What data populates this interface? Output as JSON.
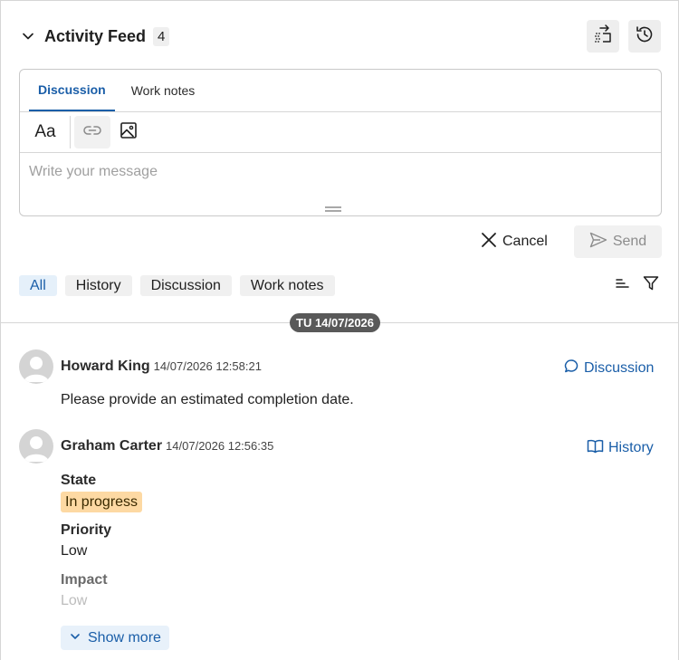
{
  "header": {
    "title": "Activity Feed",
    "count": "4"
  },
  "composer": {
    "tabs": [
      {
        "label": "Discussion"
      },
      {
        "label": "Work notes"
      }
    ],
    "toolbar": {
      "text_format_label": "Aa"
    },
    "placeholder": "Write your message"
  },
  "actions": {
    "cancel_label": "Cancel",
    "send_label": "Send"
  },
  "filters": [
    {
      "label": "All"
    },
    {
      "label": "History"
    },
    {
      "label": "Discussion"
    },
    {
      "label": "Work notes"
    }
  ],
  "date_separator": "TU 14/07/2026",
  "entries": [
    {
      "author": "Howard King",
      "timestamp": "14/07/2026 12:58:21",
      "type": "Discussion",
      "message": "Please provide an estimated completion date."
    },
    {
      "author": "Graham Carter",
      "timestamp": "14/07/2026 12:56:35",
      "type": "History",
      "fields": [
        {
          "label": "State",
          "value": "In progress"
        },
        {
          "label": "Priority",
          "value": "Low"
        },
        {
          "label": "Impact",
          "value": "Low"
        }
      ],
      "show_more_label": "Show more"
    }
  ],
  "colors": {
    "accent": "#1a5ea8",
    "state_badge": "#fdd9a3",
    "date_pill": "#595959"
  },
  "icons": [
    "chevron-down-icon",
    "reorder-icon",
    "history-icon",
    "link-icon",
    "image-icon",
    "close-icon",
    "send-icon",
    "sort-icon",
    "filter-icon",
    "avatar-icon",
    "chat-bubble-icon",
    "book-icon"
  ]
}
